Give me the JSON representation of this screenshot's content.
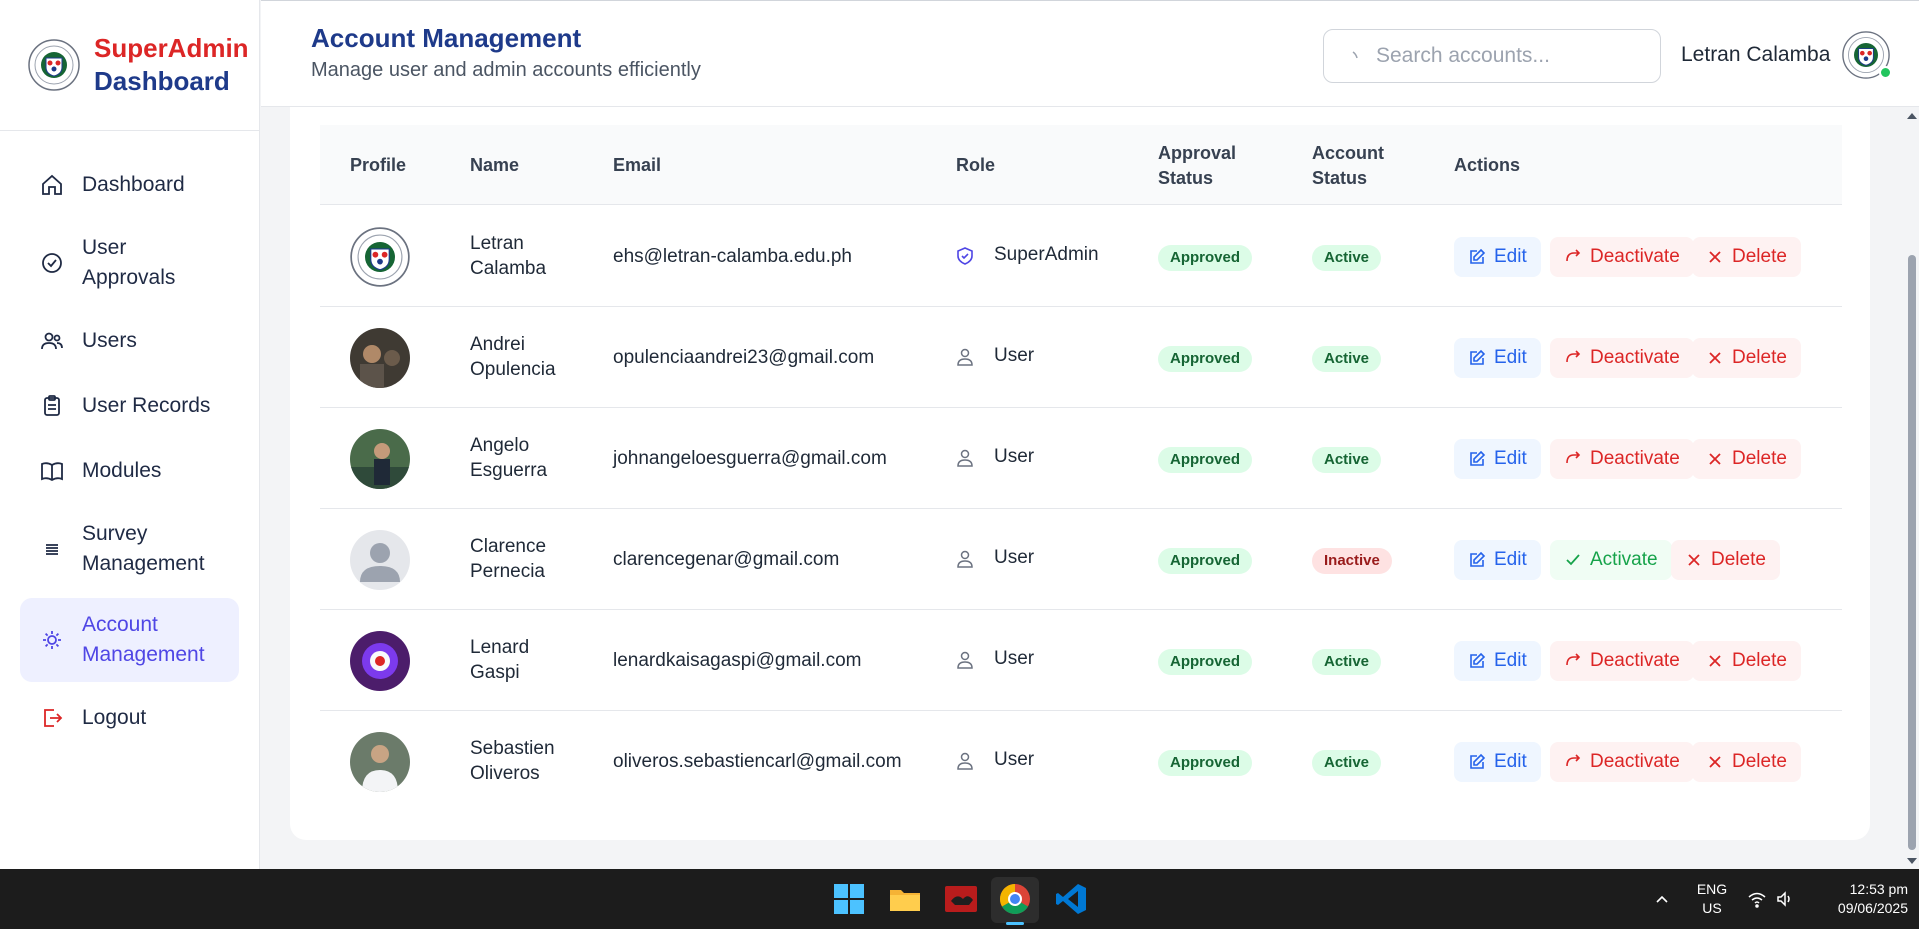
{
  "brand": {
    "line1": "SuperAdmin",
    "line2": "Dashboard"
  },
  "sidebar": {
    "items": [
      {
        "label": "Dashboard",
        "icon": "home-icon"
      },
      {
        "label": "User Approvals",
        "icon": "check-circle-icon"
      },
      {
        "label": "Users",
        "icon": "users-icon"
      },
      {
        "label": "User Records",
        "icon": "clipboard-icon"
      },
      {
        "label": "Modules",
        "icon": "book-icon"
      },
      {
        "label": "Survey Management",
        "icon": "list-icon"
      },
      {
        "label": "Account Management",
        "icon": "user-cog-icon",
        "active": true
      },
      {
        "label": "Logout",
        "icon": "logout-icon"
      }
    ]
  },
  "header": {
    "title": "Account Management",
    "subtitle": "Manage user and admin accounts efficiently",
    "search_placeholder": "Search accounts...",
    "user_name": "Letran Calamba"
  },
  "table": {
    "headers": {
      "profile": "Profile",
      "name": "Name",
      "email": "Email",
      "role": "Role",
      "approval_status": "Approval Status",
      "account_status": "Account Status",
      "actions": "Actions"
    },
    "rows": [
      {
        "name": "Letran Calamba",
        "email": "ehs@letran-calamba.edu.ph",
        "role": "SuperAdmin",
        "approval": "Approved",
        "status": "Active",
        "toggle": "Deactivate"
      },
      {
        "name": "Andrei Opulencia",
        "email": "opulenciaandrei23@gmail.com",
        "role": "User",
        "approval": "Approved",
        "status": "Active",
        "toggle": "Deactivate"
      },
      {
        "name": "Angelo Esguerra",
        "email": "johnangeloesguerra@gmail.com",
        "role": "User",
        "approval": "Approved",
        "status": "Active",
        "toggle": "Deactivate"
      },
      {
        "name": "Clarence Pernecia",
        "email": "clarencegenar@gmail.com",
        "role": "User",
        "approval": "Approved",
        "status": "Inactive",
        "toggle": "Activate"
      },
      {
        "name": "Lenard Gaspi",
        "email": "lenardkaisagaspi@gmail.com",
        "role": "User",
        "approval": "Approved",
        "status": "Active",
        "toggle": "Deactivate"
      },
      {
        "name": "Sebastien Oliveros",
        "email": "oliveros.sebastiencarl@gmail.com",
        "role": "User",
        "approval": "Approved",
        "status": "Active",
        "toggle": "Deactivate"
      }
    ],
    "edit_label": "Edit",
    "delete_label": "Delete"
  },
  "taskbar": {
    "lang_line1": "ENG",
    "lang_line2": "US",
    "time": "12:53 pm",
    "date": "09/06/2025"
  },
  "colors": {
    "brand_red": "#dc2626",
    "brand_navy": "#1e3a8a",
    "accent": "#4f46e5",
    "approved_bg": "#dcfce7",
    "inactive_bg": "#fee2e2"
  }
}
